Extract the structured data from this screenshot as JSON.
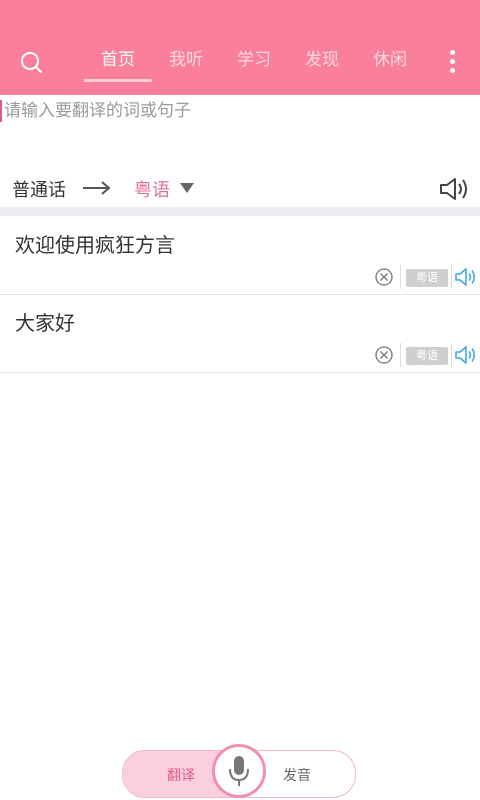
{
  "header": {
    "tabs": [
      {
        "label": "首页",
        "active": true
      },
      {
        "label": "我听",
        "active": false
      },
      {
        "label": "学习",
        "active": false
      },
      {
        "label": "发现",
        "active": false
      },
      {
        "label": "休闲",
        "active": false
      }
    ],
    "icons": {
      "search": "search-icon",
      "more": "more-vertical-icon"
    },
    "bg_color": "#f97f9a"
  },
  "translate": {
    "placeholder": "请输入要翻译的词或句子",
    "source_language": "普通话",
    "target_language": "粤语"
  },
  "history": [
    {
      "text": "欢迎使用疯狂方言",
      "badge": "粤语"
    },
    {
      "text": "大家好",
      "badge": "粤语"
    }
  ],
  "bottom_bar": {
    "left_label": "翻译",
    "right_label": "发音",
    "mic_icon": "microphone-icon"
  }
}
